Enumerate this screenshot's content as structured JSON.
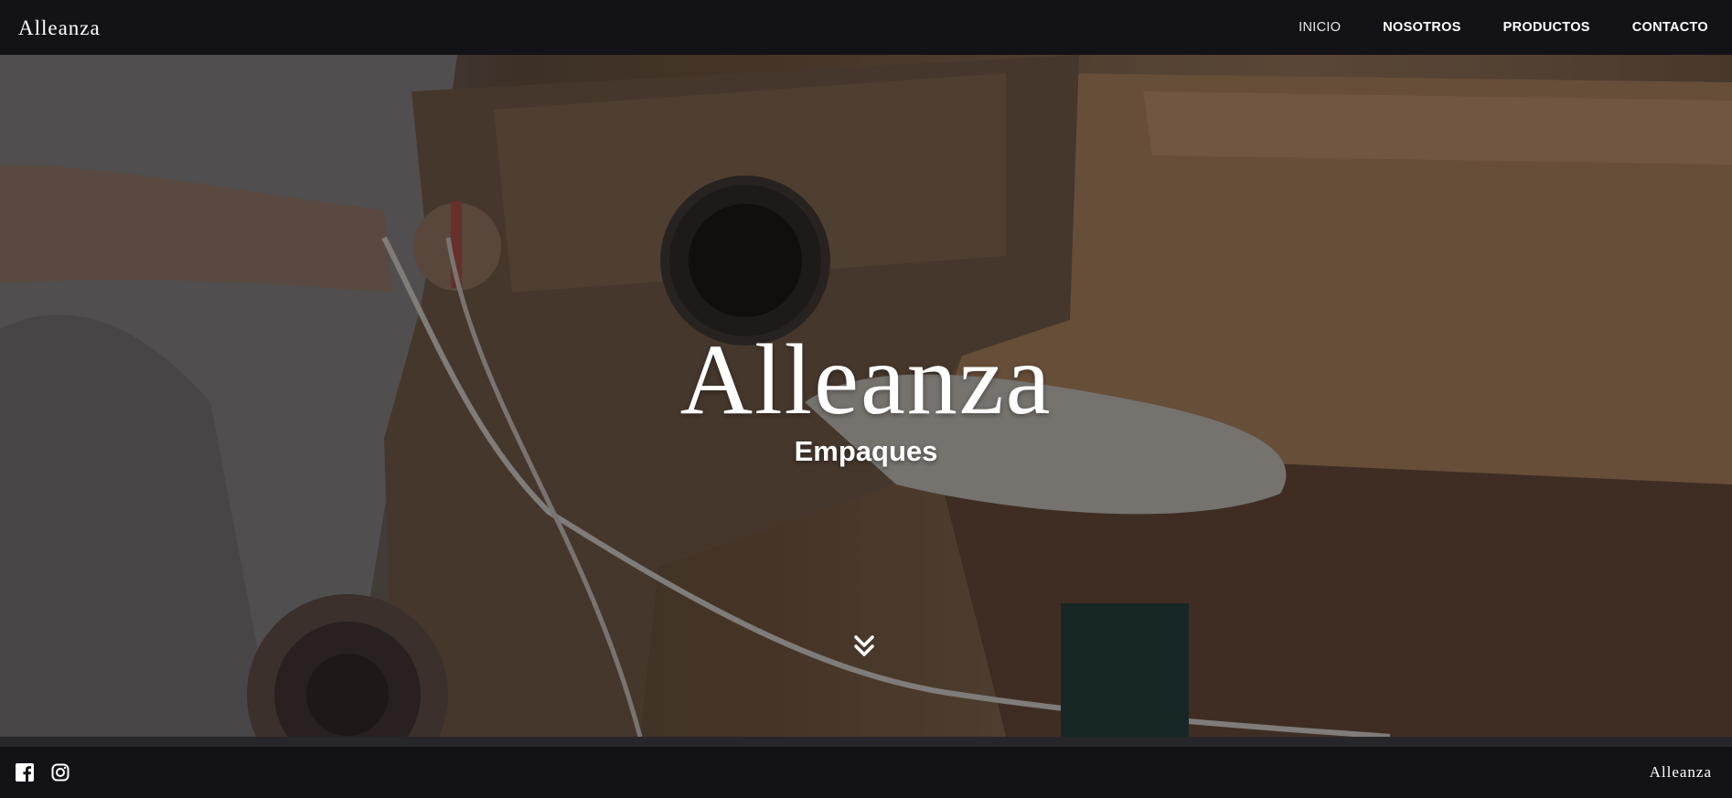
{
  "header": {
    "logo_text": "Alleanza",
    "nav": [
      {
        "label": "INICIO",
        "active": true
      },
      {
        "label": "NOSOTROS",
        "active": false
      },
      {
        "label": "PRODUCTOS",
        "active": false
      },
      {
        "label": "CONTACTO",
        "active": false
      }
    ]
  },
  "hero": {
    "logo_text": "Alleanza",
    "subtitle": "Empaques",
    "scroll_icon": "double-chevron-down-icon",
    "background_icon": "factory-machine-photo"
  },
  "footer": {
    "social": [
      {
        "icon": "facebook-icon"
      },
      {
        "icon": "instagram-icon"
      }
    ],
    "logo_text": "Alleanza"
  },
  "colors": {
    "header_bg": "#131217",
    "footer_bg": "#131217",
    "text": "#ffffff"
  }
}
